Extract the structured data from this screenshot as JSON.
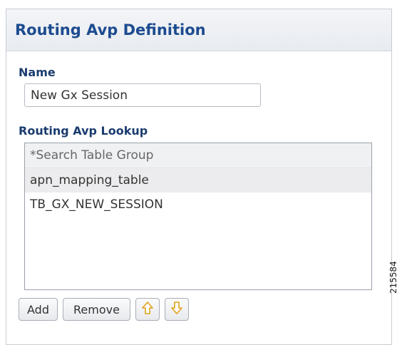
{
  "panel": {
    "title": "Routing Avp Definition"
  },
  "name_section": {
    "label": "Name",
    "value": "New Gx Session"
  },
  "lookup_section": {
    "label": "Routing Avp Lookup",
    "header_item": "*Search Table Group",
    "items": [
      {
        "label": "apn_mapping_table",
        "selected": true
      },
      {
        "label": "TB_GX_NEW_SESSION",
        "selected": false
      }
    ]
  },
  "buttons": {
    "add": "Add",
    "remove": "Remove",
    "move_up_icon": "arrow-up-icon",
    "move_down_icon": "arrow-down-icon"
  },
  "figure_id": "215584",
  "colors": {
    "title": "#1d4b8f",
    "label": "#1a3c6e",
    "arrow": "#e0a21a"
  }
}
